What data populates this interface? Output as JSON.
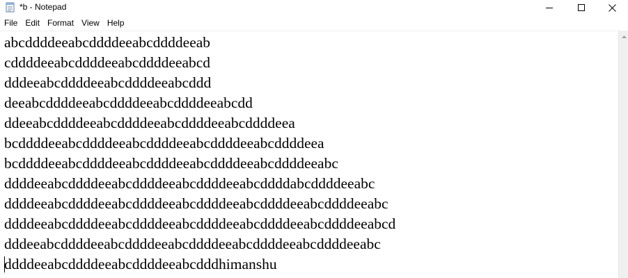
{
  "window": {
    "title": "*b - Notepad"
  },
  "menu": {
    "items": [
      "File",
      "Edit",
      "Format",
      "View",
      "Help"
    ]
  },
  "editor": {
    "lines": [
      "abcddddeeabcddddeeabcddddeeab",
      "cddddeeabcddddeeabcddddeeabcd",
      "dddeeabcddddeeabcddddeeabcddd",
      "deeabcddddeeabcddddeeabcddddeeabcdd",
      "ddeeabcddddeeabcddddeeabcddddeeabcddddeea",
      "bcddddeeabcddddeeabcddddeeabcddddeeabcddddeea",
      "bcddddeeabcddddeeabcddddeeabcddddeeabcddddeeabc",
      "ddddeeabcddddeeabcddddeeabcddddeeabcddddabcddddeeabc",
      "ddddeeabcddddeeabcddddeeabcddddeeabcddddeeabcddddeeabc",
      "ddddeeabcddddeeabcddddeeabcddddeeabcddddeeabcddddeeabcd",
      "dddeeabcddddeeabcddddeeabcddddeeabcddddeeabcddddeeabc",
      "ddddeeabcddddeeabcddddeeabcdddhimanshu"
    ]
  },
  "colors": {
    "background": "#ffffff",
    "text": "#000000",
    "scrollbar": "#f0f0f0"
  },
  "icons": {
    "app": "notepad-icon",
    "minimize": "minimize-icon",
    "maximize": "maximize-icon",
    "close": "close-icon",
    "scroll_up": "scroll-up-arrow-icon"
  }
}
